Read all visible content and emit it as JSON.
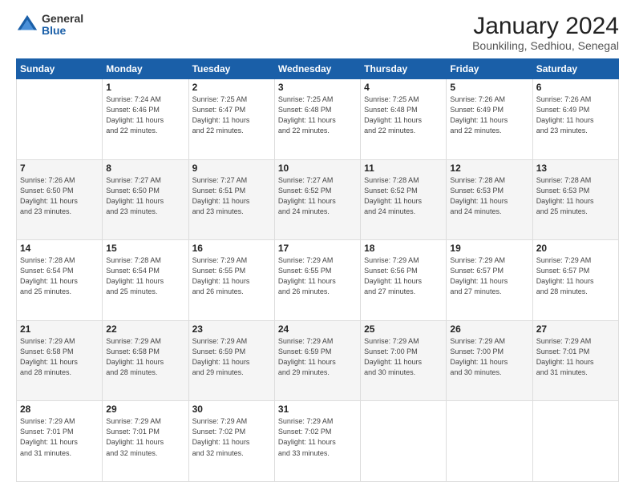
{
  "logo": {
    "general": "General",
    "blue": "Blue"
  },
  "header": {
    "title": "January 2024",
    "subtitle": "Bounkiling, Sedhiou, Senegal"
  },
  "days_of_week": [
    "Sunday",
    "Monday",
    "Tuesday",
    "Wednesday",
    "Thursday",
    "Friday",
    "Saturday"
  ],
  "weeks": [
    [
      {
        "day": "",
        "info": ""
      },
      {
        "day": "1",
        "info": "Sunrise: 7:24 AM\nSunset: 6:46 PM\nDaylight: 11 hours\nand 22 minutes."
      },
      {
        "day": "2",
        "info": "Sunrise: 7:25 AM\nSunset: 6:47 PM\nDaylight: 11 hours\nand 22 minutes."
      },
      {
        "day": "3",
        "info": "Sunrise: 7:25 AM\nSunset: 6:48 PM\nDaylight: 11 hours\nand 22 minutes."
      },
      {
        "day": "4",
        "info": "Sunrise: 7:25 AM\nSunset: 6:48 PM\nDaylight: 11 hours\nand 22 minutes."
      },
      {
        "day": "5",
        "info": "Sunrise: 7:26 AM\nSunset: 6:49 PM\nDaylight: 11 hours\nand 22 minutes."
      },
      {
        "day": "6",
        "info": "Sunrise: 7:26 AM\nSunset: 6:49 PM\nDaylight: 11 hours\nand 23 minutes."
      }
    ],
    [
      {
        "day": "7",
        "info": "Sunrise: 7:26 AM\nSunset: 6:50 PM\nDaylight: 11 hours\nand 23 minutes."
      },
      {
        "day": "8",
        "info": "Sunrise: 7:27 AM\nSunset: 6:50 PM\nDaylight: 11 hours\nand 23 minutes."
      },
      {
        "day": "9",
        "info": "Sunrise: 7:27 AM\nSunset: 6:51 PM\nDaylight: 11 hours\nand 23 minutes."
      },
      {
        "day": "10",
        "info": "Sunrise: 7:27 AM\nSunset: 6:52 PM\nDaylight: 11 hours\nand 24 minutes."
      },
      {
        "day": "11",
        "info": "Sunrise: 7:28 AM\nSunset: 6:52 PM\nDaylight: 11 hours\nand 24 minutes."
      },
      {
        "day": "12",
        "info": "Sunrise: 7:28 AM\nSunset: 6:53 PM\nDaylight: 11 hours\nand 24 minutes."
      },
      {
        "day": "13",
        "info": "Sunrise: 7:28 AM\nSunset: 6:53 PM\nDaylight: 11 hours\nand 25 minutes."
      }
    ],
    [
      {
        "day": "14",
        "info": "Sunrise: 7:28 AM\nSunset: 6:54 PM\nDaylight: 11 hours\nand 25 minutes."
      },
      {
        "day": "15",
        "info": "Sunrise: 7:28 AM\nSunset: 6:54 PM\nDaylight: 11 hours\nand 25 minutes."
      },
      {
        "day": "16",
        "info": "Sunrise: 7:29 AM\nSunset: 6:55 PM\nDaylight: 11 hours\nand 26 minutes."
      },
      {
        "day": "17",
        "info": "Sunrise: 7:29 AM\nSunset: 6:55 PM\nDaylight: 11 hours\nand 26 minutes."
      },
      {
        "day": "18",
        "info": "Sunrise: 7:29 AM\nSunset: 6:56 PM\nDaylight: 11 hours\nand 27 minutes."
      },
      {
        "day": "19",
        "info": "Sunrise: 7:29 AM\nSunset: 6:57 PM\nDaylight: 11 hours\nand 27 minutes."
      },
      {
        "day": "20",
        "info": "Sunrise: 7:29 AM\nSunset: 6:57 PM\nDaylight: 11 hours\nand 28 minutes."
      }
    ],
    [
      {
        "day": "21",
        "info": "Sunrise: 7:29 AM\nSunset: 6:58 PM\nDaylight: 11 hours\nand 28 minutes."
      },
      {
        "day": "22",
        "info": "Sunrise: 7:29 AM\nSunset: 6:58 PM\nDaylight: 11 hours\nand 28 minutes."
      },
      {
        "day": "23",
        "info": "Sunrise: 7:29 AM\nSunset: 6:59 PM\nDaylight: 11 hours\nand 29 minutes."
      },
      {
        "day": "24",
        "info": "Sunrise: 7:29 AM\nSunset: 6:59 PM\nDaylight: 11 hours\nand 29 minutes."
      },
      {
        "day": "25",
        "info": "Sunrise: 7:29 AM\nSunset: 7:00 PM\nDaylight: 11 hours\nand 30 minutes."
      },
      {
        "day": "26",
        "info": "Sunrise: 7:29 AM\nSunset: 7:00 PM\nDaylight: 11 hours\nand 30 minutes."
      },
      {
        "day": "27",
        "info": "Sunrise: 7:29 AM\nSunset: 7:01 PM\nDaylight: 11 hours\nand 31 minutes."
      }
    ],
    [
      {
        "day": "28",
        "info": "Sunrise: 7:29 AM\nSunset: 7:01 PM\nDaylight: 11 hours\nand 31 minutes."
      },
      {
        "day": "29",
        "info": "Sunrise: 7:29 AM\nSunset: 7:01 PM\nDaylight: 11 hours\nand 32 minutes."
      },
      {
        "day": "30",
        "info": "Sunrise: 7:29 AM\nSunset: 7:02 PM\nDaylight: 11 hours\nand 32 minutes."
      },
      {
        "day": "31",
        "info": "Sunrise: 7:29 AM\nSunset: 7:02 PM\nDaylight: 11 hours\nand 33 minutes."
      },
      {
        "day": "",
        "info": ""
      },
      {
        "day": "",
        "info": ""
      },
      {
        "day": "",
        "info": ""
      }
    ]
  ]
}
